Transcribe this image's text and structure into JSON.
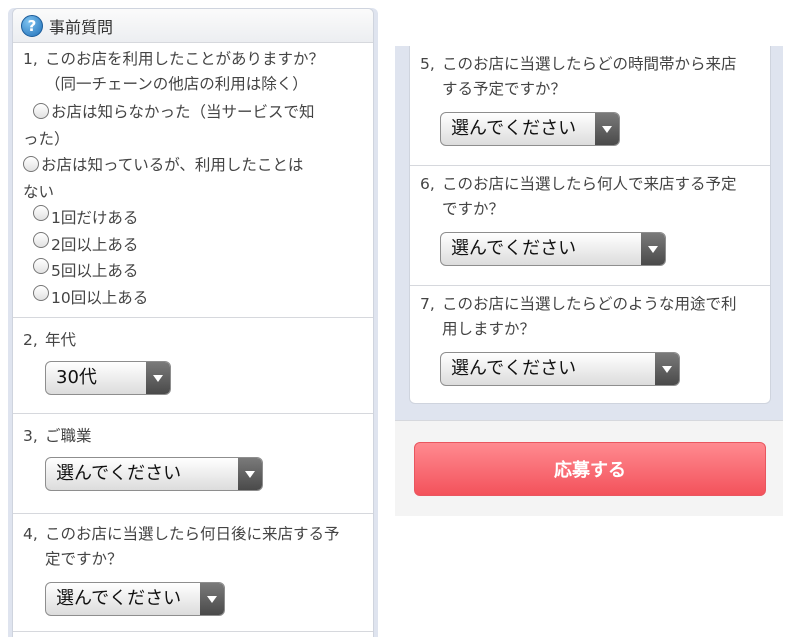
{
  "header": {
    "title": "事前質問",
    "icon": "help-icon"
  },
  "q1": {
    "num": "1,",
    "text": "このお店を利用したことがありますか？",
    "subtext": "（同一チェーンの他店の利用は除く）",
    "options": [
      {
        "line1": "お店は知らなかった（当サービスで知",
        "line2": "った）"
      },
      {
        "line1": "お店は知っているが、利用したことは",
        "line2": "ない"
      },
      {
        "line1": "1回だけある"
      },
      {
        "line1": "2回以上ある"
      },
      {
        "line1": "5回以上ある"
      },
      {
        "line1": "10回以上ある"
      }
    ]
  },
  "q2": {
    "num": "2,",
    "text": "年代",
    "select_value": "30代"
  },
  "q3": {
    "num": "3,",
    "text": "ご職業",
    "select_value": "選んでください"
  },
  "q4": {
    "num": "4,",
    "line1": "このお店に当選したら何日後に来店する予",
    "line2": "定ですか？",
    "select_value": "選んでください"
  },
  "q5": {
    "num": "5,",
    "line1": "このお店に当選したらどの時間帯から来店",
    "line2": "する予定ですか？",
    "select_value": "選んでください"
  },
  "q6": {
    "num": "6,",
    "line1": "このお店に当選したら何人で来店する予定",
    "line2": "ですか？",
    "select_value": "選んでください"
  },
  "q7": {
    "num": "7,",
    "line1": "このお店に当選したらどのような用途で利",
    "line2": "用しますか？",
    "select_value": "選んでください"
  },
  "submit": {
    "label": "応募する"
  },
  "colors": {
    "accent": "#f3525b",
    "panel_bg": "#dfe4ef"
  }
}
